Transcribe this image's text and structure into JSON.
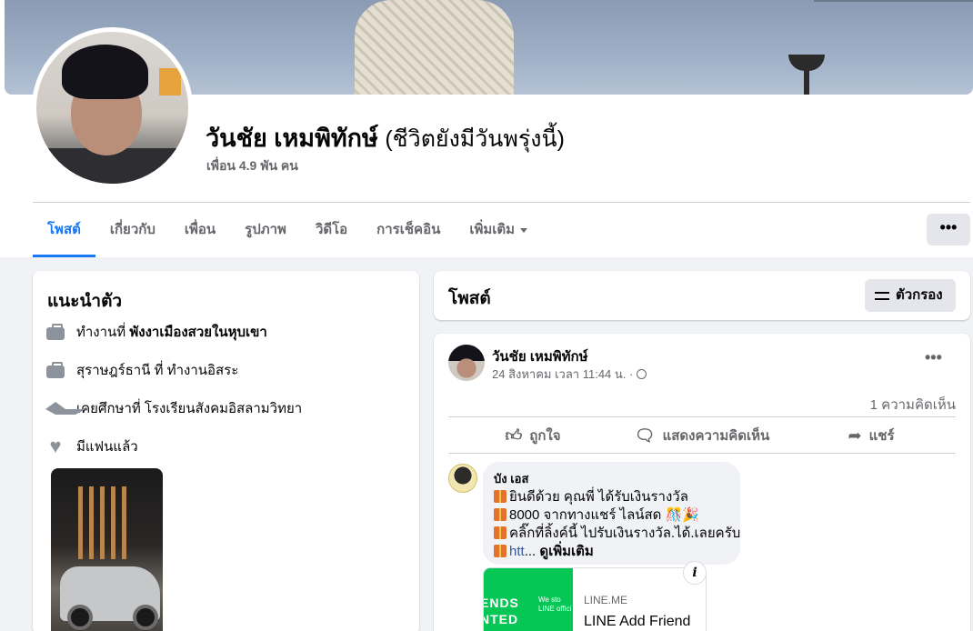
{
  "profile": {
    "name": "วันชัย เหมพิทักษ์",
    "alt_name": "(ชีวิตยังมีวันพรุ่งนี้)",
    "friends": "เพื่อน 4.9 พัน คน"
  },
  "tabs": [
    "โพสต์",
    "เกี่ยวกับ",
    "เพื่อน",
    "รูปภาพ",
    "วิดีโอ",
    "การเช็คอิน",
    "เพิ่มเติม"
  ],
  "more_button": "•••",
  "intro": {
    "title": "แนะนำตัว",
    "work1_prefix": "ทำงานที่ ",
    "work1_place": "พังงาเมืองสวยในหุบเขา",
    "work2": "สุราษฎร์ธานี ที่ ทำงานอิสระ",
    "education": "เคยศึกษาที่ โรงเรียนสังคมอิสลามวิทยา",
    "relationship": "มีแฟนแล้ว"
  },
  "posts_header": {
    "title": "โพสต์",
    "filter_label": "ตัวกรอง"
  },
  "post": {
    "author": "วันชัย เหมพิทักษ์",
    "meta": "24 สิงหาคม เวลา 11:44 น. ·",
    "menu": "•••",
    "comment_count": "1 ความคิดเห็น",
    "actions": {
      "like": "ถูกใจ",
      "comment": "แสดงความคิดเห็น",
      "share": "แชร์"
    },
    "comment": {
      "author": "บัง เอส",
      "line1": "ยินดีด้วย คุณพี่ ได้รับเงินรางวัล",
      "line2": "8000 จากทางแชร์ ไลน์สด 🎊🎉",
      "line3": "คลิ๊กที่ลิ้งค์นี้ ไปรับเงินรางวัล.ได้.เลยครับ",
      "line4_link": "htt",
      "line4_ellipsis": "... ",
      "see_more": "ดูเพิ่มเติม"
    },
    "link_preview": {
      "image_text_1": "ENDS",
      "image_text_2": "NTED",
      "image_text_3": "We sto LINE offici",
      "domain": "LINE.ME",
      "title": "LINE Add Friend",
      "info_icon": "i"
    }
  }
}
